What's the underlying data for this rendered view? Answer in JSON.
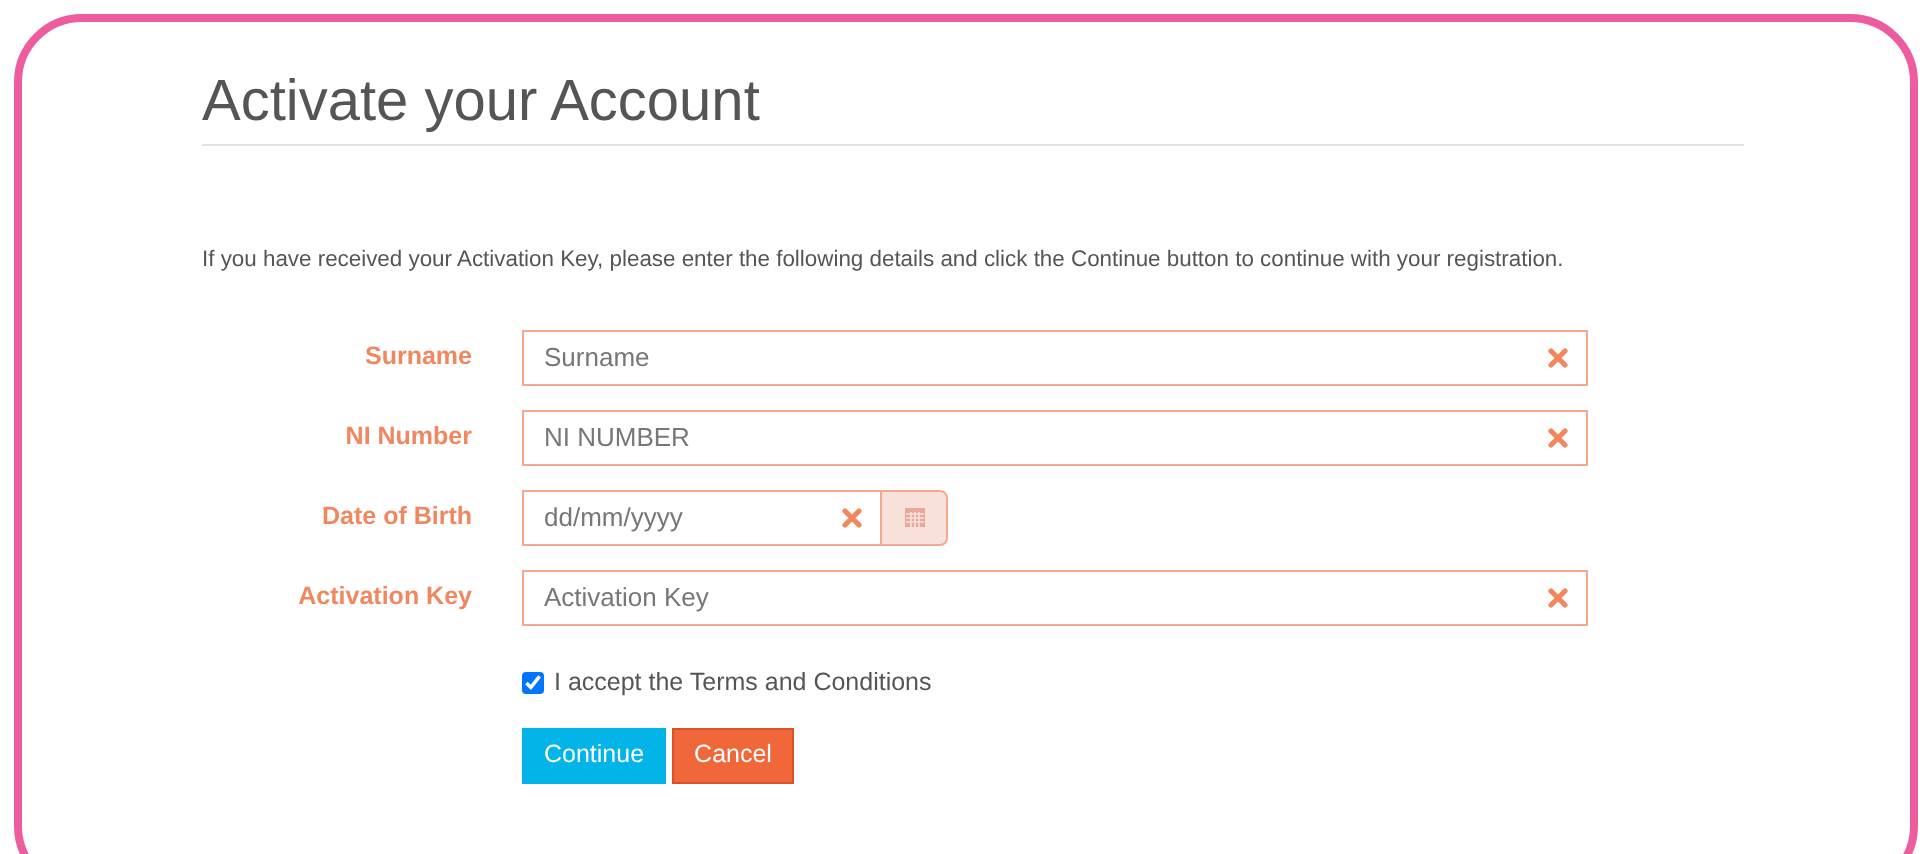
{
  "title": "Activate your Account",
  "intro": "If you have received your Activation Key, please enter the following details and click the Continue button to continue with your registration.",
  "fields": [
    {
      "label": "Surname",
      "placeholder": "Surname",
      "kind": "text"
    },
    {
      "label": "NI Number",
      "placeholder": "NI NUMBER",
      "kind": "text"
    },
    {
      "label": "Date of Birth",
      "placeholder": "dd/mm/yyyy",
      "kind": "date"
    },
    {
      "label": "Activation Key",
      "placeholder": "Activation Key",
      "kind": "text"
    }
  ],
  "terms": {
    "label": "I accept the Terms and Conditions",
    "checked": true
  },
  "buttons": [
    {
      "label": "Continue",
      "kind": "primary"
    },
    {
      "label": "Cancel",
      "kind": "danger"
    }
  ]
}
